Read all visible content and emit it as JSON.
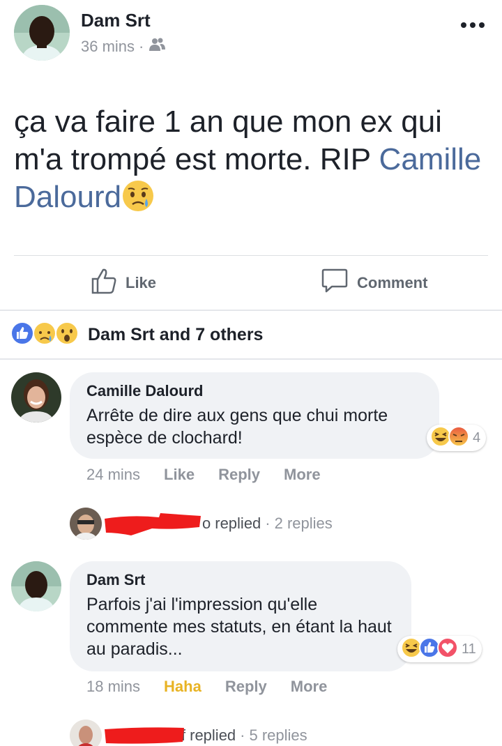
{
  "post": {
    "author": "Dam Srt",
    "time": "36 mins",
    "meta_separator": "·",
    "audience_icon": "friends-icon",
    "text_main": "ça va faire 1 an que mon ex qui m'a trompé est morte. RIP",
    "tagged_name": "Camille Dalourd",
    "text_emoji": "crying-face-icon"
  },
  "actions": {
    "like_label": "Like",
    "comment_label": "Comment"
  },
  "reactions": {
    "summary_text": "Dam Srt and 7 others",
    "icons": [
      "like-reaction-icon",
      "sad-reaction-icon",
      "wow-reaction-icon"
    ],
    "colors": {
      "like": "#4a76e8",
      "emoji_yellow": "#f7c94b",
      "angry": "#e9573f",
      "love": "#f25268",
      "haha_text": "#e8b324"
    }
  },
  "comments": [
    {
      "author": "Camille Dalourd",
      "text": "Arrête de dire aux gens que chui morte espèce de clochard!",
      "time": "24 mins",
      "like_label": "Like",
      "reply_label": "Reply",
      "more_label": "More",
      "reaction_count": "4",
      "reaction_icons": [
        "haha-reaction-icon",
        "angry-reaction-icon"
      ],
      "replies": {
        "name_suffix": "o",
        "replied_label": "replied",
        "separator": "·",
        "count_label": "2 replies"
      }
    },
    {
      "author": "Dam Srt",
      "text": "Parfois j'ai l'impression qu'elle commente mes statuts, en étant la haut au paradis...",
      "time": "18 mins",
      "like_label": "Haha",
      "reply_label": "Reply",
      "more_label": "More",
      "reaction_count": "11",
      "reaction_icons": [
        "haha-reaction-icon",
        "like-reaction-icon",
        "love-reaction-icon"
      ],
      "replies": {
        "name_suffix": "f",
        "replied_label": "replied",
        "separator": "·",
        "count_label": "5 replies"
      }
    }
  ]
}
